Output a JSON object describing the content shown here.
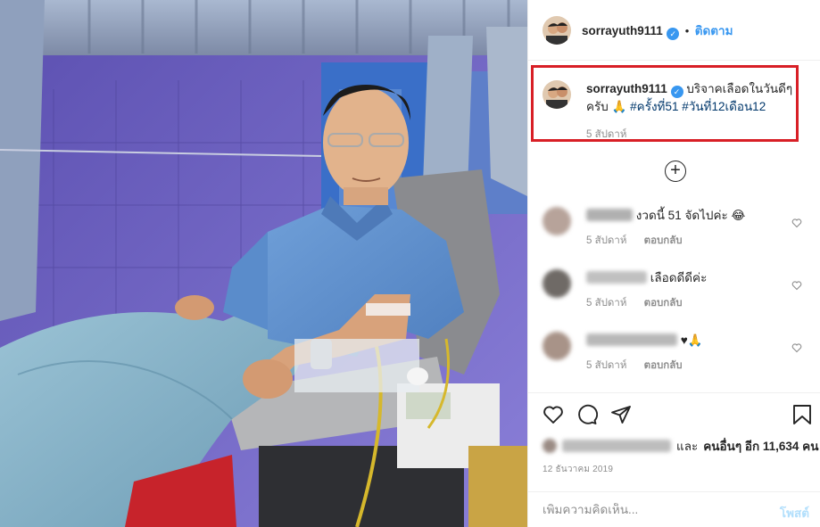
{
  "post": {
    "author": "sorrayuth9111",
    "follow_label": "ติดตาม",
    "dot": "•",
    "caption_text": "บริจาคเลือดในวันดีๆ ครับ 🙏 ",
    "hashtags": [
      "#ครั้งที่51",
      "#วันที่12เดือน12"
    ],
    "caption_time": "5 สัปดาห์",
    "load_more": "+"
  },
  "comments": [
    {
      "text": "งวดนี้ 51 จัดไปค่ะ 😂",
      "time": "5 สัปดาห์",
      "reply": "ตอบกลับ"
    },
    {
      "text": "เลือดดีดีค่ะ",
      "time": "5 สัปดาห์",
      "reply": "ตอบกลับ"
    },
    {
      "text": "♥🙏",
      "time": "5 สัปดาห์",
      "reply": "ตอบกลับ"
    }
  ],
  "likes": {
    "suffix": "และ",
    "others": "คนอื่นๆ อีก 11,634 คน"
  },
  "date": "12 ธันวาคม 2019",
  "add_comment": {
    "placeholder": "เพิ่มความคิดเห็น...",
    "post_label": "โพสต์"
  },
  "icons": [
    "verified-badge-icon",
    "heart-icon",
    "comment-icon",
    "share-icon",
    "bookmark-icon",
    "plus-circle-icon"
  ],
  "colors": {
    "accent": "#3897f0",
    "highlight_border": "#d81f26",
    "muted": "#8e8e8e"
  }
}
